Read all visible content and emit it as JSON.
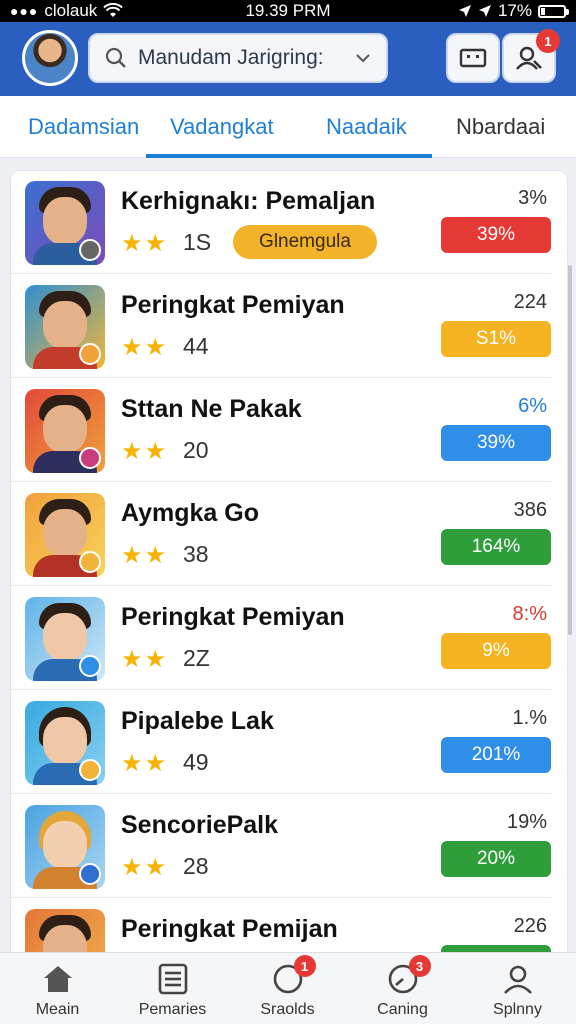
{
  "status_bar": {
    "carrier": "clolauk",
    "time": "19.39 PRM",
    "battery": "17%"
  },
  "header": {
    "search_text": "Manudam Jarigring:",
    "notification_badge": "1"
  },
  "tabs": [
    {
      "label": "Dadamsian",
      "active": false
    },
    {
      "label": "Vadangkat",
      "active": true
    },
    {
      "label": "Naadaik",
      "active": false
    },
    {
      "label": "Nbardaai",
      "active": false
    }
  ],
  "rows": [
    {
      "name": "Kerhignakı: Pemaljan",
      "stars": "★★",
      "score": "1S",
      "tag": "Glnemgula",
      "small": "3%",
      "small_color": "#333333",
      "pill": "39%",
      "pill_color": "#e53935"
    },
    {
      "name": "Peringkat Pemiyan",
      "stars": "★★",
      "score": "44",
      "tag": "",
      "small": "224",
      "small_color": "#333333",
      "pill": "S1%",
      "pill_color": "#f5b321"
    },
    {
      "name": "Sttan Ne Pakak",
      "stars": "★★",
      "score": "20",
      "tag": "",
      "small": "6%",
      "small_color": "#1e7fd6",
      "pill": "39%",
      "pill_color": "#2f8ee8"
    },
    {
      "name": "Aymgka Go",
      "stars": "★★",
      "score": "38",
      "tag": "",
      "small": "386",
      "small_color": "#333333",
      "pill": "164%",
      "pill_color": "#2e9e3a"
    },
    {
      "name": "Peringkat Pemiyan",
      "stars": "★★",
      "score": "2Z",
      "tag": "",
      "small": "8:%",
      "small_color": "#d43a2f",
      "pill": "9%",
      "pill_color": "#f5b321"
    },
    {
      "name": "Pipalebe Lak",
      "stars": "★★",
      "score": "49",
      "tag": "",
      "small": "1.%",
      "small_color": "#333333",
      "pill": "201%",
      "pill_color": "#2f8ee8"
    },
    {
      "name": "SencoriePalk",
      "stars": "★★",
      "score": "28",
      "tag": "",
      "small": "19%",
      "small_color": "#333333",
      "pill": "20%",
      "pill_color": "#2e9e3a"
    },
    {
      "name": "Peringkat Pemijan",
      "stars": "★★",
      "score": "",
      "tag": "",
      "small": "226",
      "small_color": "#333333",
      "pill": "",
      "pill_color": "#2e9e3a"
    }
  ],
  "bottom_nav": [
    {
      "label": "Meain",
      "icon": "home-icon",
      "badge": ""
    },
    {
      "label": "Pemaries",
      "icon": "list-icon",
      "badge": ""
    },
    {
      "label": "Sraolds",
      "icon": "circle-icon",
      "badge": "1"
    },
    {
      "label": "Caning",
      "icon": "gauge-icon",
      "badge": "3"
    },
    {
      "label": "Splnny",
      "icon": "person-icon",
      "badge": ""
    }
  ],
  "colors": {
    "header": "#2a5fbf",
    "accent": "#1e7fd6",
    "star": "#f5b400"
  }
}
